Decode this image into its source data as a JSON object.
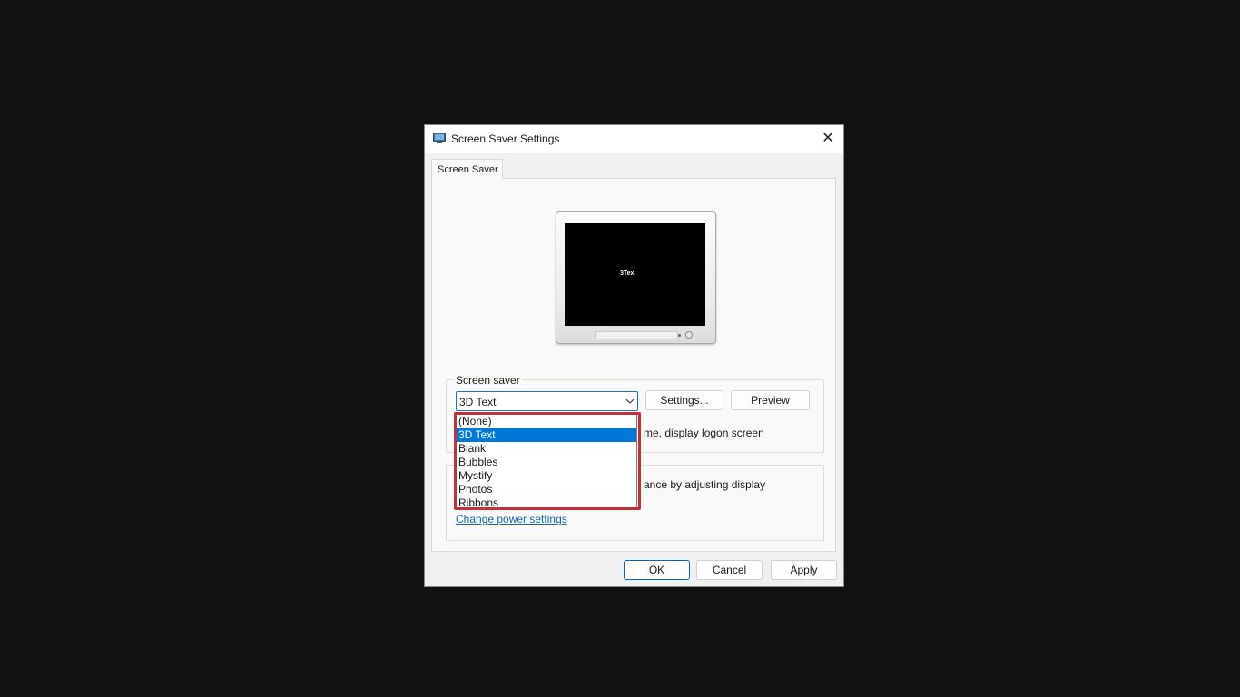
{
  "window": {
    "title": "Screen Saver Settings",
    "close_glyph": "✕",
    "icon": "monitor-icon"
  },
  "tabs": [
    {
      "label": "Screen Saver"
    }
  ],
  "preview": {
    "screen_text": "3Tex"
  },
  "screen_saver": {
    "group_label": "Screen saver",
    "selected": "3D Text",
    "settings_button": "Settings...",
    "preview_button": "Preview",
    "resume_text": "me, display logon screen",
    "options": [
      "(None)",
      "3D Text",
      "Blank",
      "Bubbles",
      "Mystify",
      "Photos",
      "Ribbons"
    ],
    "selected_index": 1
  },
  "power": {
    "text": "ance by adjusting display",
    "link": "Change power settings"
  },
  "footer": {
    "ok": "OK",
    "cancel": "Cancel",
    "apply": "Apply"
  },
  "colors": {
    "highlight": "#c62f3a",
    "selection": "#0078d7",
    "link": "#1565a8"
  }
}
